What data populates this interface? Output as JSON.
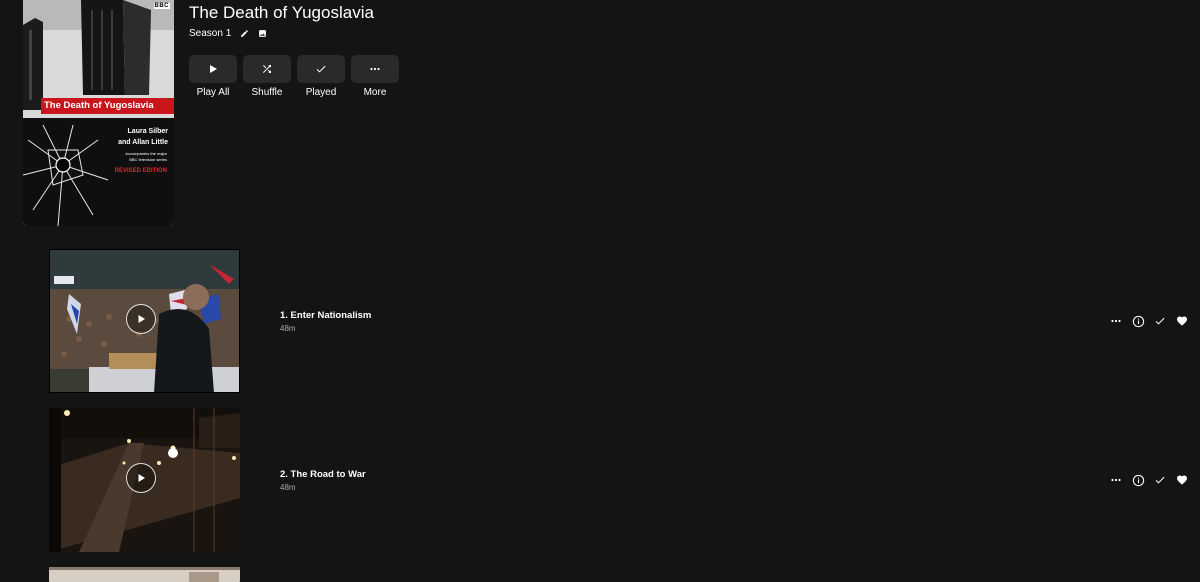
{
  "series": {
    "title": "The Death of Yugoslavia",
    "season_label": "Season 1",
    "poster": {
      "publisher_mark": "BBC",
      "book_title": "The Death of Yugoslavia",
      "authors_line1": "Laura Silber",
      "authors_line2": "and Allan Little",
      "subtitle_line1": "Accompanies the major",
      "subtitle_line2": "BBC television series",
      "edition": "REVISED EDITION"
    }
  },
  "actions": [
    {
      "label": "Play All",
      "icon": "play-icon"
    },
    {
      "label": "Shuffle",
      "icon": "shuffle-icon"
    },
    {
      "label": "Played",
      "icon": "check-icon"
    },
    {
      "label": "More",
      "icon": "more-icon"
    }
  ],
  "episodes": [
    {
      "title": "1. Enter Nationalism",
      "duration": "48m"
    },
    {
      "title": "2. The Road to War",
      "duration": "48m"
    }
  ],
  "colors": {
    "background": "#141414",
    "button": "#2a2a2a",
    "poster_banner": "#c8161c"
  }
}
